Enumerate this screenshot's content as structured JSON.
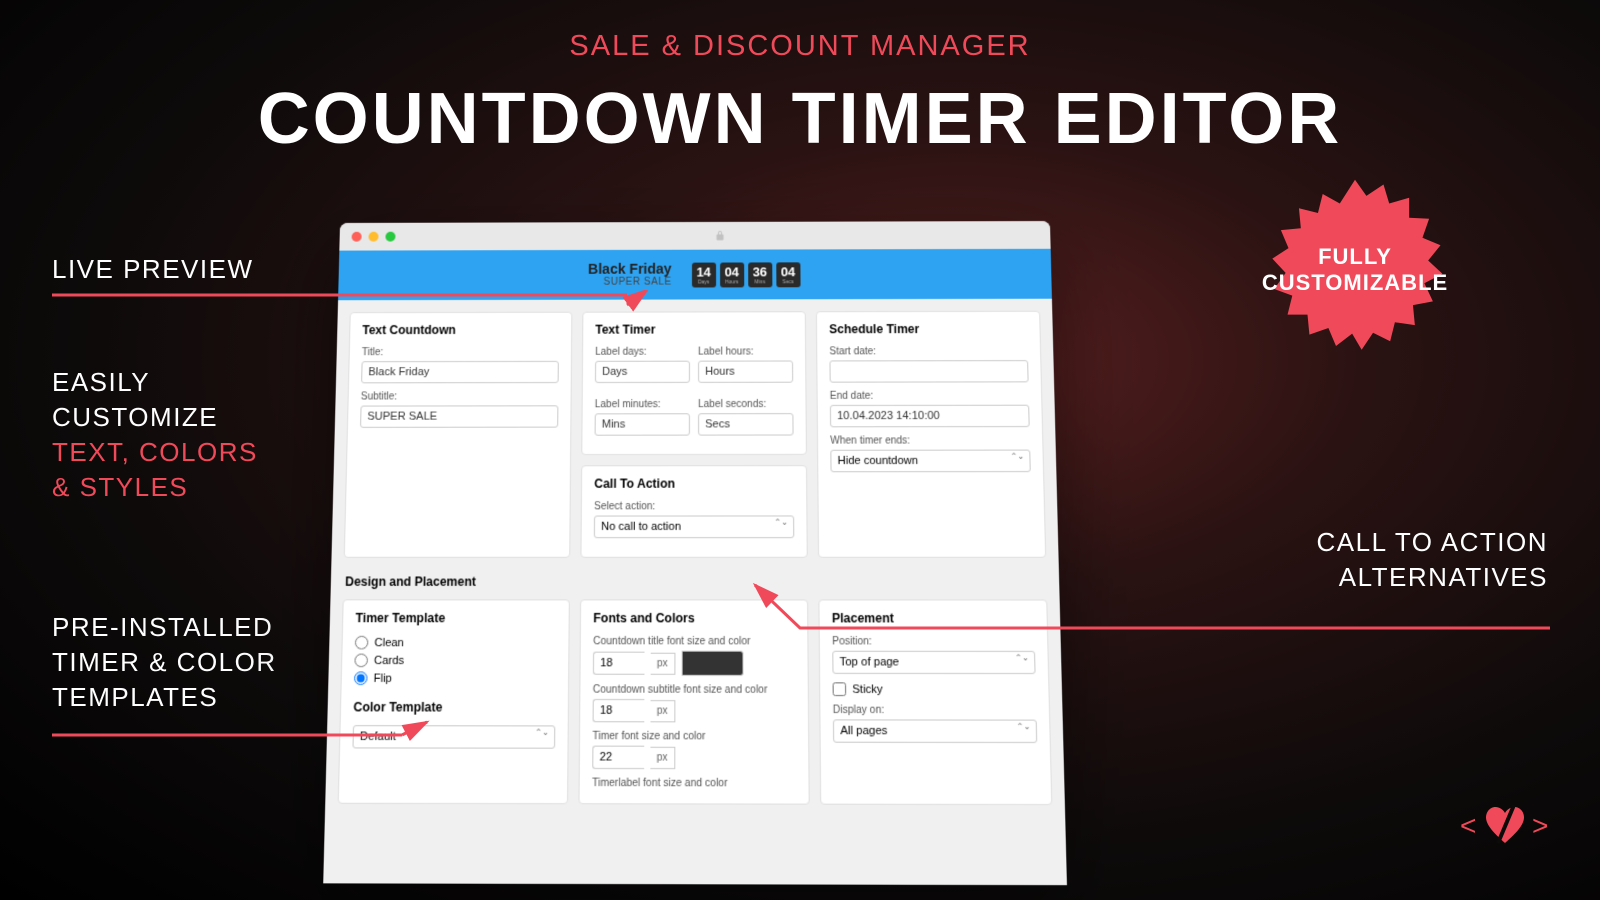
{
  "promo": {
    "subtitle": "SALE & DISCOUNT MANAGER",
    "title": "COUNTDOWN TIMER EDITOR",
    "starburst_line1": "FULLY",
    "starburst_line2": "CUSTOMIZABLE"
  },
  "callouts": {
    "live_preview": "LIVE PREVIEW",
    "customize_l1": "EASILY",
    "customize_l2": "CUSTOMIZE",
    "customize_l3": "TEXT, COLORS",
    "customize_l4": "& STYLES",
    "templates_l1": "PRE-INSTALLED",
    "templates_l2": "TIMER & COLOR",
    "templates_l3": "TEMPLATES",
    "cta_l1": "CALL TO ACTION",
    "cta_l2": "ALTERNATIVES"
  },
  "preview": {
    "title": "Black Friday",
    "subtitle": "SUPER SALE",
    "timer": {
      "days": "14",
      "days_lbl": "Days",
      "hours": "04",
      "hours_lbl": "Hours",
      "mins": "36",
      "mins_lbl": "Mins",
      "secs": "04",
      "secs_lbl": "Secs"
    }
  },
  "cards": {
    "text_countdown": {
      "heading": "Text Countdown",
      "title_label": "Title:",
      "title_value": "Black Friday",
      "subtitle_label": "Subtitle:",
      "subtitle_value": "SUPER SALE"
    },
    "text_timer": {
      "heading": "Text Timer",
      "label_days": "Label days:",
      "label_days_value": "Days",
      "label_hours": "Label hours:",
      "label_hours_value": "Hours",
      "label_minutes": "Label minutes:",
      "label_minutes_value": "Mins",
      "label_seconds": "Label seconds:",
      "label_seconds_value": "Secs"
    },
    "cta": {
      "heading": "Call To Action",
      "select_label": "Select action:",
      "select_value": "No call to action"
    },
    "schedule": {
      "heading": "Schedule Timer",
      "start_label": "Start date:",
      "start_value": "",
      "end_label": "End date:",
      "end_value": "10.04.2023 14:10:00",
      "when_ends_label": "When timer ends:",
      "when_ends_value": "Hide countdown"
    },
    "design_heading": "Design and Placement",
    "timer_template": {
      "heading": "Timer Template",
      "opt_clean": "Clean",
      "opt_cards": "Cards",
      "opt_flip": "Flip",
      "color_heading": "Color Template",
      "color_value": "Default"
    },
    "fonts_colors": {
      "heading": "Fonts and Colors",
      "title_font_label": "Countdown title font size and color",
      "title_font_size": "18",
      "subtitle_font_label": "Countdown subtitle font size and color",
      "subtitle_font_size": "18",
      "timer_font_label": "Timer font size and color",
      "timer_font_size": "22",
      "timerlabel_font_label": "Timerlabel font size and color",
      "px": "px"
    },
    "placement": {
      "heading": "Placement",
      "position_label": "Position:",
      "position_value": "Top of page",
      "sticky_label": "Sticky",
      "display_label": "Display on:",
      "display_value": "All pages"
    }
  }
}
